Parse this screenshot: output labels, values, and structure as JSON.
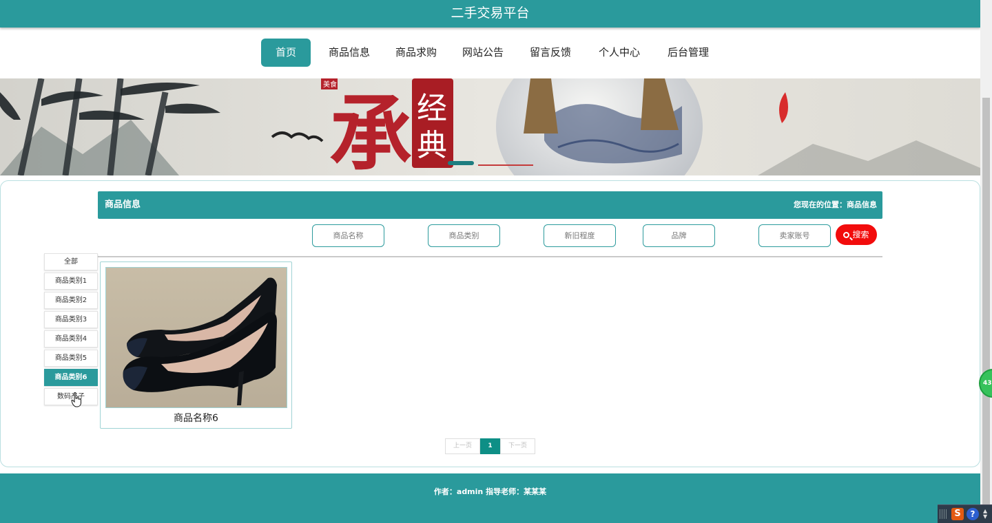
{
  "site": {
    "title": "二手交易平台"
  },
  "nav": {
    "items": [
      {
        "label": "首页",
        "active": true
      },
      {
        "label": "商品信息"
      },
      {
        "label": "商品求购"
      },
      {
        "label": "网站公告"
      },
      {
        "label": "留言反馈"
      },
      {
        "label": "个人中心"
      },
      {
        "label": "后台管理"
      }
    ]
  },
  "banner": {
    "seal_text_1": "经",
    "seal_text_2": "典",
    "calligraphy": "承",
    "small_stamp": "美食",
    "slide_count": 2,
    "active_slide": 1
  },
  "section": {
    "title": "商品信息",
    "location": "您现在的位置：商品信息"
  },
  "filters": {
    "name_placeholder": "商品名称",
    "category_placeholder": "商品类别",
    "condition_placeholder": "新旧程度",
    "brand_placeholder": "品牌",
    "seller_placeholder": "卖家账号",
    "search_label": "搜索"
  },
  "categories": [
    {
      "label": "全部"
    },
    {
      "label": "商品类别1"
    },
    {
      "label": "商品类别2"
    },
    {
      "label": "商品类别3"
    },
    {
      "label": "商品类别4"
    },
    {
      "label": "商品类别5"
    },
    {
      "label": "商品类别6",
      "active": true
    },
    {
      "label": "数码产子"
    }
  ],
  "products": [
    {
      "name": "商品名称6",
      "image": "black-high-heels"
    }
  ],
  "pagination": {
    "prev": "上一页",
    "current": "1",
    "next": "下一页"
  },
  "footer": {
    "text": "作者：admin 指导老师：某某某"
  },
  "overlay": {
    "badge": "43"
  },
  "colors": {
    "primary": "#2a9a9c",
    "search": "#f20c0c",
    "page_active": "#0e8f86"
  }
}
